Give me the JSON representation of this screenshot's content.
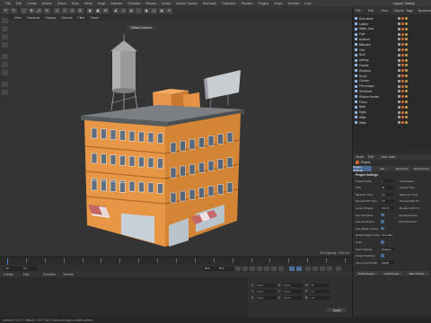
{
  "menu": [
    "File",
    "Edit",
    "Create",
    "Modes",
    "Select",
    "Tools",
    "Mesh",
    "Snap",
    "Animate",
    "Simulate",
    "Render",
    "Sculpt",
    "Motion Tracker",
    "MoGraph",
    "Character",
    "Pipeline",
    "Plugins",
    "Script",
    "Window",
    "Help"
  ],
  "layout_label": "Layout: Startup",
  "viewport": {
    "menu": [
      "View",
      "Cameras",
      "Display",
      "Options",
      "Filter",
      "Panel"
    ],
    "camera_label": "Default Camera",
    "status": "Grid Spacing : 1000 cm"
  },
  "timeline": {
    "ticks": [
      "0",
      "5",
      "10",
      "15",
      "20",
      "25",
      "30",
      "35",
      "40",
      "45",
      "50",
      "55",
      "60",
      "65",
      "70",
      "75",
      "80",
      "85",
      "90"
    ],
    "start": "0 F",
    "end": "90 F",
    "current": "0 F",
    "fps_end": "90 F"
  },
  "bottom": {
    "menu": [
      "Create",
      "Edit",
      "Function",
      "Texture"
    ],
    "coords": {
      "rows": [
        [
          "X",
          "0 cm",
          "X",
          "0 cm",
          "H",
          "0 °"
        ],
        [
          "Y",
          "0 cm",
          "Y",
          "0 cm",
          "P",
          "0 °"
        ],
        [
          "Z",
          "0 cm",
          "Z",
          "0 cm",
          "B",
          "0 °"
        ]
      ],
      "apply": "Apply"
    }
  },
  "status_text": "Azimuth: 142.1°, Altitude: 12.6° SW | Click and drag to rotate camera",
  "object_manager": {
    "menu": [
      "File",
      "Edit",
      "View",
      "Objects",
      "Tags",
      "Bookmarks"
    ],
    "objects": [
      "Roof detail",
      "Ladder",
      "Water_tank",
      "Pipe",
      "Antenna",
      "Billboard",
      "Trim",
      "Roof",
      "Awning",
      "Facade",
      "Windows",
      "Doors",
      "Cornice",
      "Fire escape",
      "Storefront",
      "Window frames",
      "Floors",
      "Base",
      "Signs",
      "Walls",
      "Walls"
    ]
  },
  "attributes": {
    "menu": [
      "Mode",
      "Edit",
      "User Data"
    ],
    "title": "Project",
    "tabs": [
      "Project Settings",
      "Info",
      "Dynamics",
      "Referencing"
    ],
    "section": "Project Settings",
    "rows": [
      {
        "label": "Project Scale",
        "value": "1",
        "label2": "Centimeters"
      },
      {
        "label": "FPS",
        "value": "30",
        "label2": "Project Time"
      },
      {
        "label": "Minimum Time",
        "value": "0 F",
        "label2": "Maximum Time"
      },
      {
        "label": "Preview Min Time",
        "value": "0 F",
        "label2": "Preview Max Time"
      },
      {
        "label": "Level of Detail",
        "value": "100 %",
        "label2": "Render LOD in Editor"
      },
      {
        "label": "Use Animation",
        "value": "",
        "label2": "Use Expression"
      },
      {
        "label": "Use Generators",
        "value": "",
        "label2": "Use Deformers"
      },
      {
        "label": "Use Motion System",
        "value": "",
        "label2": ""
      },
      {
        "label": "Default Object Color",
        "value": "Gray Blue",
        "label2": ""
      },
      {
        "label": "Color",
        "value": "",
        "label2": ""
      },
      {
        "label": "View Clipping",
        "value": "Medium",
        "label2": ""
      },
      {
        "label": "Linear Workflow",
        "value": "",
        "label2": ""
      },
      {
        "label": "Input Color Profile",
        "value": "sRGB",
        "label2": ""
      }
    ],
    "buttons": [
      "Scale Project...",
      "Load Preset...",
      "Save Preset..."
    ]
  }
}
